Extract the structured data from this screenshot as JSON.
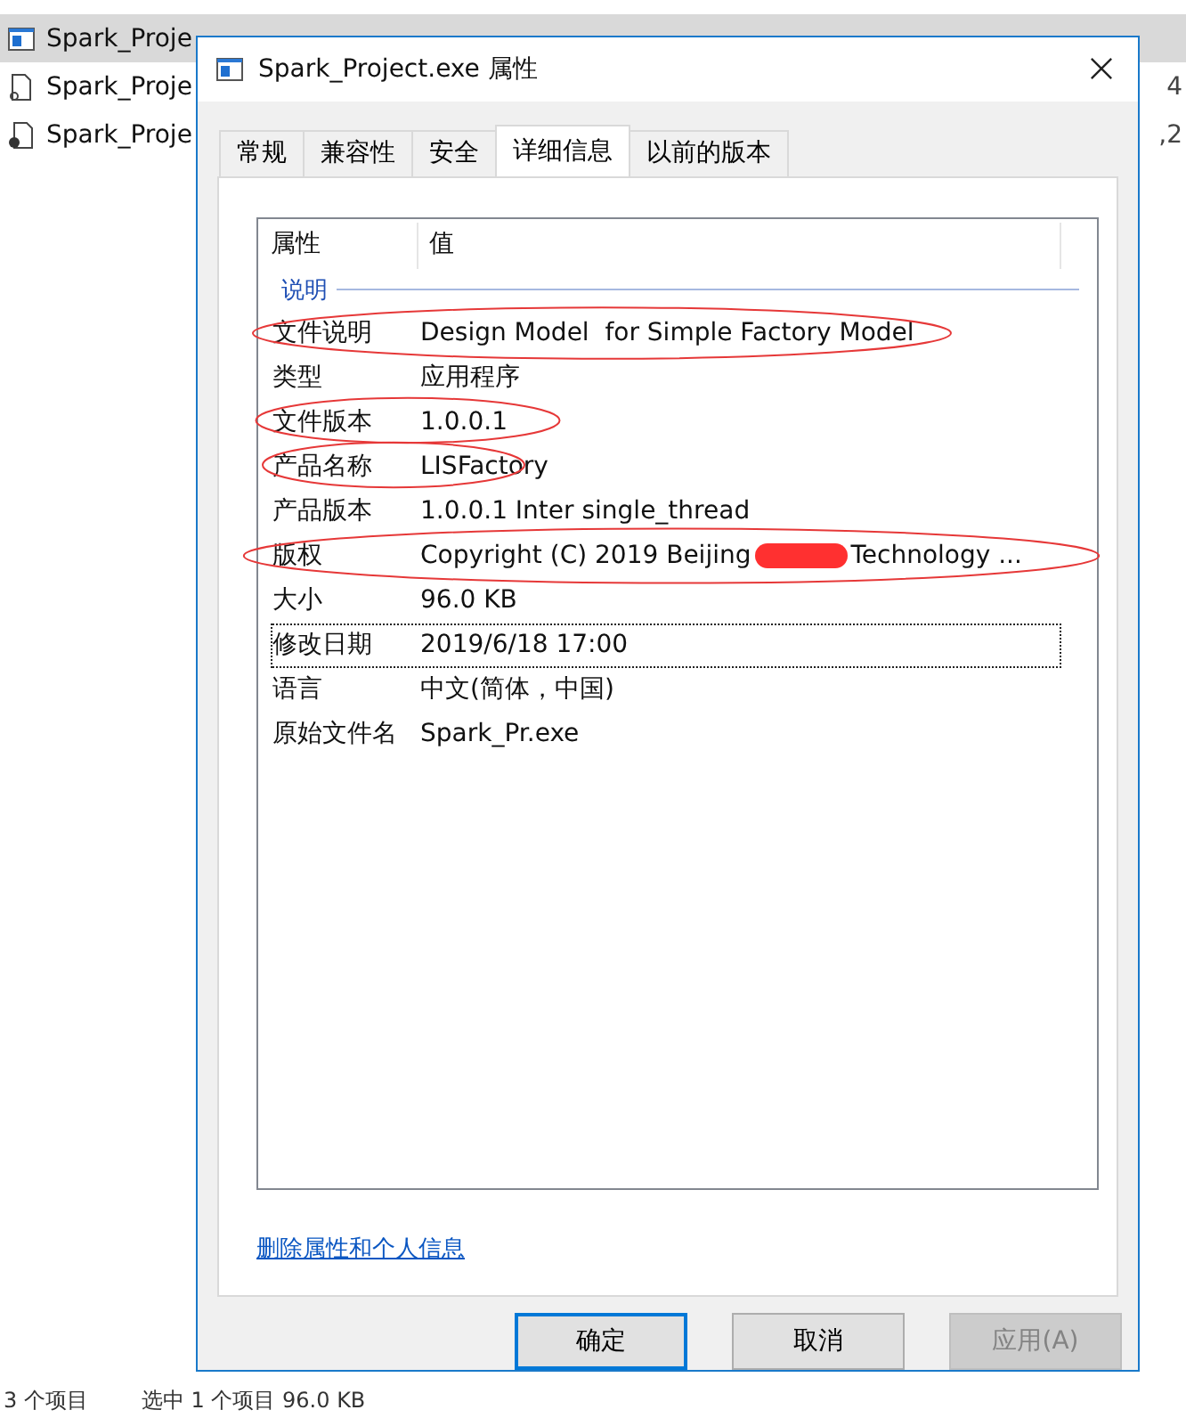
{
  "explorer": {
    "rows": [
      {
        "name": "Spark_Proje",
        "kind": "exe",
        "selected": true,
        "column_4": ""
      },
      {
        "name": "Spark_Proje",
        "kind": "file",
        "selected": false,
        "column_4": "4"
      },
      {
        "name": "Spark_Proje",
        "kind": "doc",
        "selected": false,
        "column_4": ",2"
      }
    ],
    "status_bar": [
      "3 个项目",
      "选中 1 个项目 96.0 KB"
    ]
  },
  "dialog": {
    "title": "Spark_Project.exe 属性",
    "tabs": [
      {
        "label": "常规",
        "selected": false
      },
      {
        "label": "兼容性",
        "selected": false
      },
      {
        "label": "安全",
        "selected": false
      },
      {
        "label": "详细信息",
        "selected": true
      },
      {
        "label": "以前的版本",
        "selected": false
      }
    ],
    "columns": [
      "属性",
      "值"
    ],
    "group": "说明",
    "rows": [
      {
        "property": "文件说明",
        "value": "Design Model  for Simple Factory Model",
        "circled": true,
        "focused": false
      },
      {
        "property": "类型",
        "value": "应用程序",
        "circled": false,
        "focused": false
      },
      {
        "property": "文件版本",
        "value": "1.0.0.1",
        "circled": true,
        "focused": false
      },
      {
        "property": "产品名称",
        "value": "LISFactory",
        "circled": true,
        "focused": false
      },
      {
        "property": "产品版本",
        "value": "1.0.0.1 Inter single_thread",
        "circled": false,
        "focused": false
      },
      {
        "property": "版权",
        "value": "Copyright (C) 2019 Beijing",
        "value_after": "Technology ...",
        "redacted": true,
        "circled": true,
        "focused": false
      },
      {
        "property": "大小",
        "value": "96.0 KB",
        "circled": false,
        "focused": false
      },
      {
        "property": "修改日期",
        "value": "2019/6/18 17:00",
        "circled": false,
        "focused": true
      },
      {
        "property": "语言",
        "value": "中文(简体，中国)",
        "circled": false,
        "focused": false
      },
      {
        "property": "原始文件名",
        "value": "Spark_Pr.exe",
        "circled": false,
        "focused": false
      }
    ],
    "link": "删除属性和个人信息",
    "buttons": [
      {
        "label": "确定",
        "default": true,
        "disabled": false
      },
      {
        "label": "取消",
        "default": false,
        "disabled": false
      },
      {
        "label": "应用(A)",
        "default": false,
        "disabled": true
      }
    ]
  }
}
